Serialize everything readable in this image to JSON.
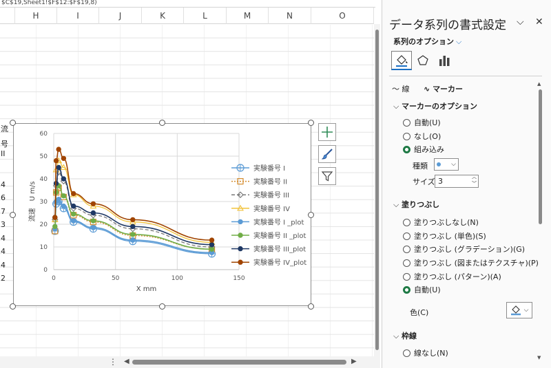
{
  "formula_text": "$C$19,Sheet1!$F$12:$F$19,8)",
  "columns": [
    "H",
    "I",
    "J",
    "K",
    "L",
    "M",
    "N",
    "O"
  ],
  "row_cells": [
    "流",
    "号 II",
    "4",
    "6",
    "7",
    "3",
    "4",
    "4",
    "4",
    "2"
  ],
  "pane": {
    "title": "データ系列の書式設定",
    "options_dropdown": "系列のオプション",
    "subtabs": {
      "line": "線",
      "marker": "マーカー"
    },
    "marker_options": {
      "heading": "マーカーのオプション",
      "items": [
        "自動(U)",
        "なし(O)",
        "組み込み"
      ],
      "selected": 2,
      "type_label": "種類",
      "size_label": "サイズ",
      "size_value": "3"
    },
    "fill": {
      "heading": "塗りつぶし",
      "items": [
        "塗りつぶしなし(N)",
        "塗りつぶし (単色)(S)",
        "塗りつぶし (グラデーション)(G)",
        "塗りつぶし (図またはテクスチャ)(P)",
        "塗りつぶし (パターン)(A)",
        "自動(U)"
      ],
      "selected": 5,
      "color_label": "色(C)"
    },
    "border": {
      "heading": "枠線",
      "items": [
        "線なし(N)"
      ]
    }
  },
  "colors": {
    "accent": "#1a6fc4",
    "selected_radio": "#1e7a45"
  },
  "chart_data": {
    "type": "line",
    "xlabel": "X mm",
    "ylabel": "流速　U m/s",
    "xlim": [
      0,
      150
    ],
    "ylim": [
      0,
      60
    ],
    "xticks": [
      0,
      50,
      100,
      150
    ],
    "yticks": [
      0,
      10,
      20,
      30,
      40,
      50,
      60
    ],
    "grid": true,
    "legend_position": "right",
    "x": [
      1,
      2,
      4,
      8,
      16,
      32,
      64,
      128
    ],
    "series": [
      {
        "name": "実験番号 I",
        "color": "#5b9bd5",
        "marker": "circle-open",
        "line": "solid",
        "values": [
          17,
          29,
          30,
          27,
          21,
          18,
          12.5,
          7
        ]
      },
      {
        "name": "実験番号 II",
        "color": "#d48c2e",
        "marker": "square-open",
        "line": "dotted",
        "values": [
          17,
          34,
          36,
          32,
          24,
          21,
          15,
          9
        ]
      },
      {
        "name": "実験番号 III",
        "color": "#777777",
        "marker": "diamond-open",
        "line": "dashed",
        "values": [
          22,
          37,
          43,
          39,
          27,
          24,
          18,
          10
        ]
      },
      {
        "name": "実験番号 IV",
        "color": "#f2c33c",
        "marker": "triangle-open",
        "line": "solid",
        "values": [
          22,
          44,
          48,
          45,
          33,
          28,
          21,
          12
        ]
      },
      {
        "name": "実験番号 I _plot",
        "color": "#5b9bd5",
        "marker": "circle",
        "line": "solid",
        "values": [
          18,
          30,
          31,
          28,
          21.5,
          18.5,
          13,
          7.5
        ]
      },
      {
        "name": "実験番号 II _plot",
        "color": "#70ad47",
        "marker": "circle",
        "line": "solid",
        "values": [
          19,
          34,
          37,
          32.5,
          24.5,
          21.5,
          15.5,
          9
        ]
      },
      {
        "name": "実験番号 III_plot",
        "color": "#1f3864",
        "marker": "circle",
        "line": "solid",
        "values": [
          23,
          38,
          45,
          40,
          28,
          25,
          19,
          11
        ]
      },
      {
        "name": "実験番号 IV_plot",
        "color": "#a04400",
        "marker": "circle",
        "line": "solid",
        "values": [
          23,
          48,
          53,
          49,
          33.5,
          29,
          22,
          13
        ]
      }
    ]
  }
}
